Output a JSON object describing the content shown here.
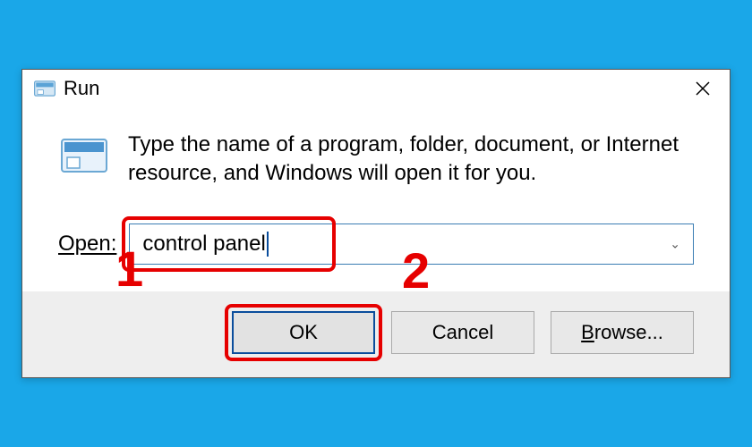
{
  "titlebar": {
    "title": "Run"
  },
  "body": {
    "instruction": "Type the name of a program, folder, document, or Internet resource, and Windows will open it for you.",
    "open_label": "Open:",
    "input_value": "control panel"
  },
  "footer": {
    "ok": "OK",
    "cancel": "Cancel",
    "browse_prefix": "B",
    "browse_rest": "rowse..."
  },
  "annotations": {
    "one": "1",
    "two": "2"
  }
}
